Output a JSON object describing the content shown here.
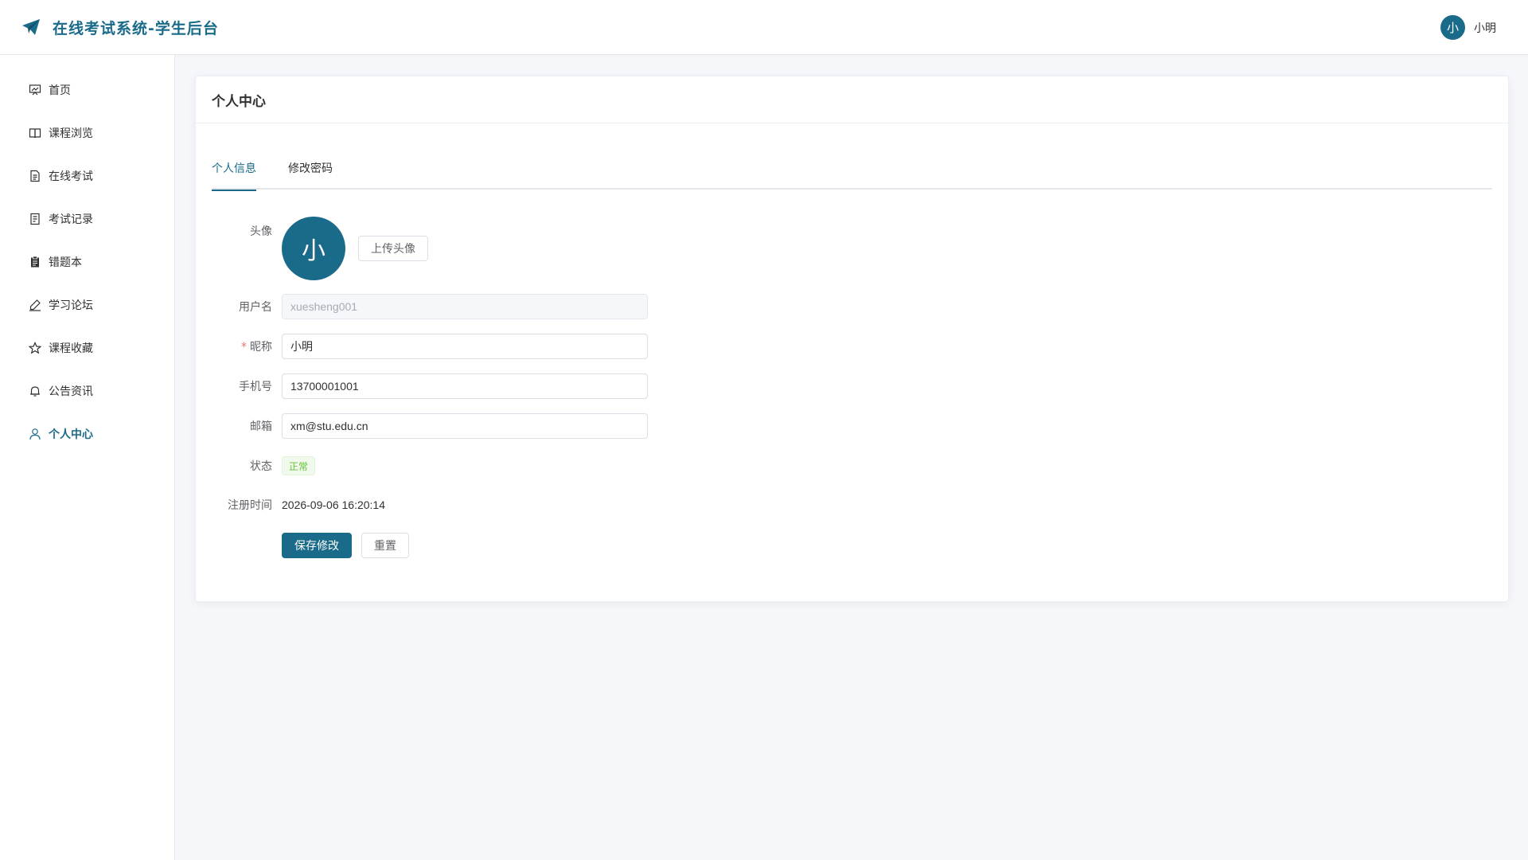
{
  "header": {
    "app_title": "在线考试系统-学生后台",
    "user_avatar_text": "小",
    "user_name": "小明"
  },
  "sidebar": {
    "items": [
      {
        "label": "首页",
        "icon": "dashboard-icon"
      },
      {
        "label": "课程浏览",
        "icon": "book-icon"
      },
      {
        "label": "在线考试",
        "icon": "document-icon"
      },
      {
        "label": "考试记录",
        "icon": "tickets-icon"
      },
      {
        "label": "错题本",
        "icon": "notebook-icon"
      },
      {
        "label": "学习论坛",
        "icon": "edit-pen-icon"
      },
      {
        "label": "课程收藏",
        "icon": "star-icon"
      },
      {
        "label": "公告资讯",
        "icon": "bell-icon"
      },
      {
        "label": "个人中心",
        "icon": "user-icon",
        "active": true
      }
    ]
  },
  "main": {
    "card_title": "个人中心",
    "tabs": [
      {
        "label": "个人信息",
        "active": true
      },
      {
        "label": "修改密码",
        "active": false
      }
    ],
    "form": {
      "avatar_label": "头像",
      "avatar_text": "小",
      "upload_button": "上传头像",
      "username_label": "用户名",
      "username_value": "xuesheng001",
      "nickname_required_mark": "*",
      "nickname_label": "昵称",
      "nickname_value": "小明",
      "phone_label": "手机号",
      "phone_value": "13700001001",
      "email_label": "邮箱",
      "email_value": "xm@stu.edu.cn",
      "status_label": "状态",
      "status_value": "正常",
      "register_time_label": "注册时间",
      "register_time_value": "2026-09-06 16:20:14",
      "save_button": "保存修改",
      "reset_button": "重置"
    }
  },
  "colors": {
    "primary": "#1a6b8a",
    "success": "#67c23a",
    "danger": "#f56c6c"
  }
}
